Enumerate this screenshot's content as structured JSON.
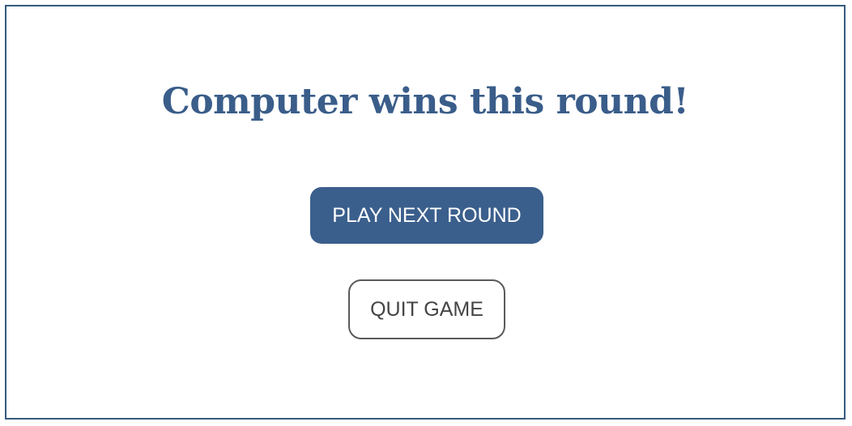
{
  "result": {
    "message": "Computer wins this round!"
  },
  "actions": {
    "play_next_label": "PLAY NEXT ROUND",
    "quit_label": "QUIT GAME"
  },
  "colors": {
    "accent": "#3b5f8c",
    "frame_border": "#365a7e",
    "title_text": "#3a5d8a",
    "secondary_border": "#5a5a5a"
  }
}
